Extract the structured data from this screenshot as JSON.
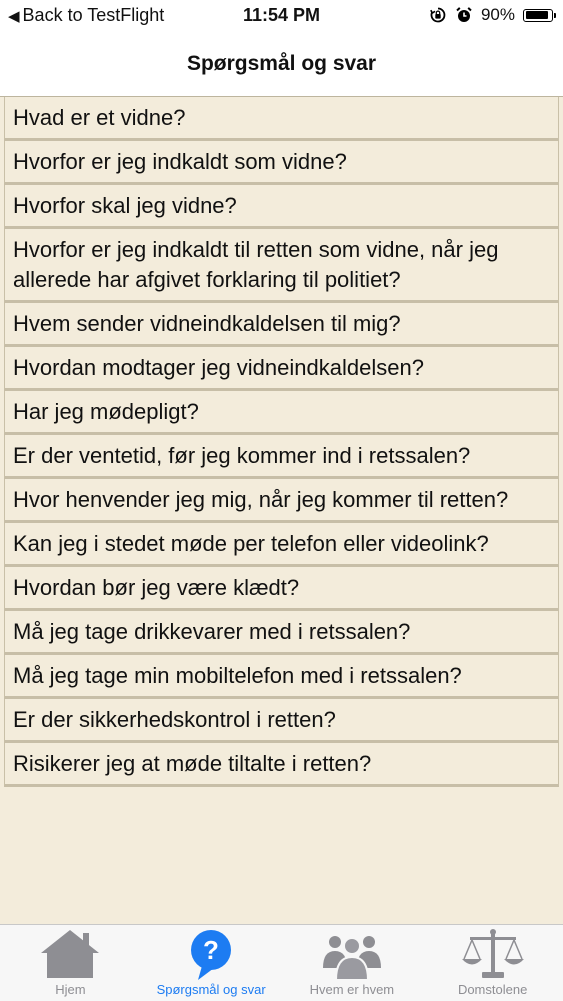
{
  "status_bar": {
    "back_label": "Back to TestFlight",
    "time": "11:54 PM",
    "battery_percent": "90%",
    "battery_level": 0.9,
    "icons": [
      "orientation-lock-icon",
      "alarm-icon",
      "battery-icon"
    ]
  },
  "nav": {
    "title": "Spørgsmål og svar"
  },
  "faq": [
    "Hvad er et vidne?",
    "Hvorfor er jeg indkaldt som vidne?",
    "Hvorfor skal jeg vidne?",
    "Hvorfor er jeg indkaldt til retten som vidne, når jeg allerede har afgivet forklaring til politiet?",
    "Hvem sender vidneindkaldelsen til mig?",
    "Hvordan modtager jeg vidneindkaldelsen?",
    "Har jeg mødepligt?",
    "Er der ventetid, før jeg kommer ind i retssalen?",
    "Hvor henvender jeg mig, når jeg kommer til retten?",
    "Kan jeg i stedet møde per telefon eller videolink?",
    "Hvordan bør jeg være klædt?",
    "Må jeg tage drikkevarer med i retssalen?",
    "Må jeg tage min mobiltelefon med i retssalen?",
    "Er der sikkerhedskontrol i retten?",
    "Risikerer jeg at møde tiltalte i retten?"
  ],
  "tabs": [
    {
      "label": "Hjem",
      "icon": "home-icon",
      "active": false
    },
    {
      "label": "Spørgsmål og svar",
      "icon": "question-icon",
      "active": true
    },
    {
      "label": "Hvem er hvem",
      "icon": "people-icon",
      "active": false
    },
    {
      "label": "Domstolene",
      "icon": "scales-icon",
      "active": false
    }
  ],
  "colors": {
    "accent": "#1d7cf2",
    "list_bg": "#f3ecdb",
    "inactive_icon": "#8e8e93"
  }
}
